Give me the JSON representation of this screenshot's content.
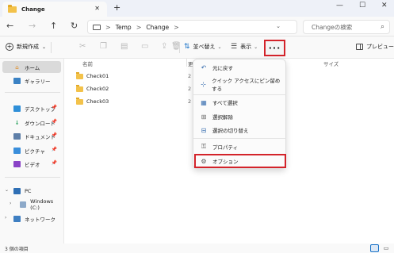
{
  "window": {
    "tab_title": "Change",
    "tab_close": "✕",
    "new_tab": "+",
    "minimize": "—",
    "maximize": "☐",
    "close": "✕"
  },
  "nav": {
    "back": "←",
    "forward": "→",
    "up": "↑",
    "refresh": "↻"
  },
  "address": {
    "crumbs": [
      "Temp",
      "Change"
    ],
    "separator": ">",
    "chevron": "⌄",
    "refresh": "↻"
  },
  "search": {
    "placeholder": "Changeの検索",
    "icon": "⌕"
  },
  "toolbar": {
    "new_label": "新規作成",
    "sort_label": "並べ替え",
    "view_label": "表示",
    "more_label": "···",
    "preview_label": "プレビュー"
  },
  "sidebar": {
    "items": [
      {
        "label": "ホーム",
        "icon": "home-icon"
      },
      {
        "label": "ギャラリー",
        "icon": "gallery-icon"
      },
      {
        "label": "デスクトップ",
        "icon": "desktop-icon"
      },
      {
        "label": "ダウンロード",
        "icon": "download-icon"
      },
      {
        "label": "ドキュメント",
        "icon": "document-icon"
      },
      {
        "label": "ピクチャ",
        "icon": "pictures-icon"
      },
      {
        "label": "ビデオ",
        "icon": "video-icon"
      },
      {
        "label": "PC",
        "icon": "pc-icon"
      },
      {
        "label": "Windows (C:)",
        "icon": "drive-icon"
      },
      {
        "label": "ネットワーク",
        "icon": "network-icon"
      }
    ]
  },
  "content": {
    "col_name": "名前",
    "col_date_frag": "更",
    "col_size": "サイズ",
    "files": [
      {
        "name": "Check01",
        "date_frag": "2"
      },
      {
        "name": "Check02",
        "date_frag": "2"
      },
      {
        "name": "Check03",
        "date_frag": "2"
      }
    ]
  },
  "menu": {
    "items": [
      {
        "label": "元に戻す",
        "icon": "undo-icon"
      },
      {
        "label": "クイック アクセスにピン留めする",
        "icon": "pin-icon"
      },
      {
        "label": "すべて選択",
        "icon": "select-all-icon"
      },
      {
        "label": "選択解除",
        "icon": "select-none-icon"
      },
      {
        "label": "選択の切り替え",
        "icon": "invert-selection-icon"
      },
      {
        "label": "プロパティ",
        "icon": "properties-icon"
      },
      {
        "label": "オプション",
        "icon": "options-icon"
      }
    ]
  },
  "status": {
    "item_count": "3 個の項目"
  },
  "colors": {
    "highlight": "#d3232a",
    "accent": "#1a73c8",
    "folder": "#f3c24a"
  }
}
